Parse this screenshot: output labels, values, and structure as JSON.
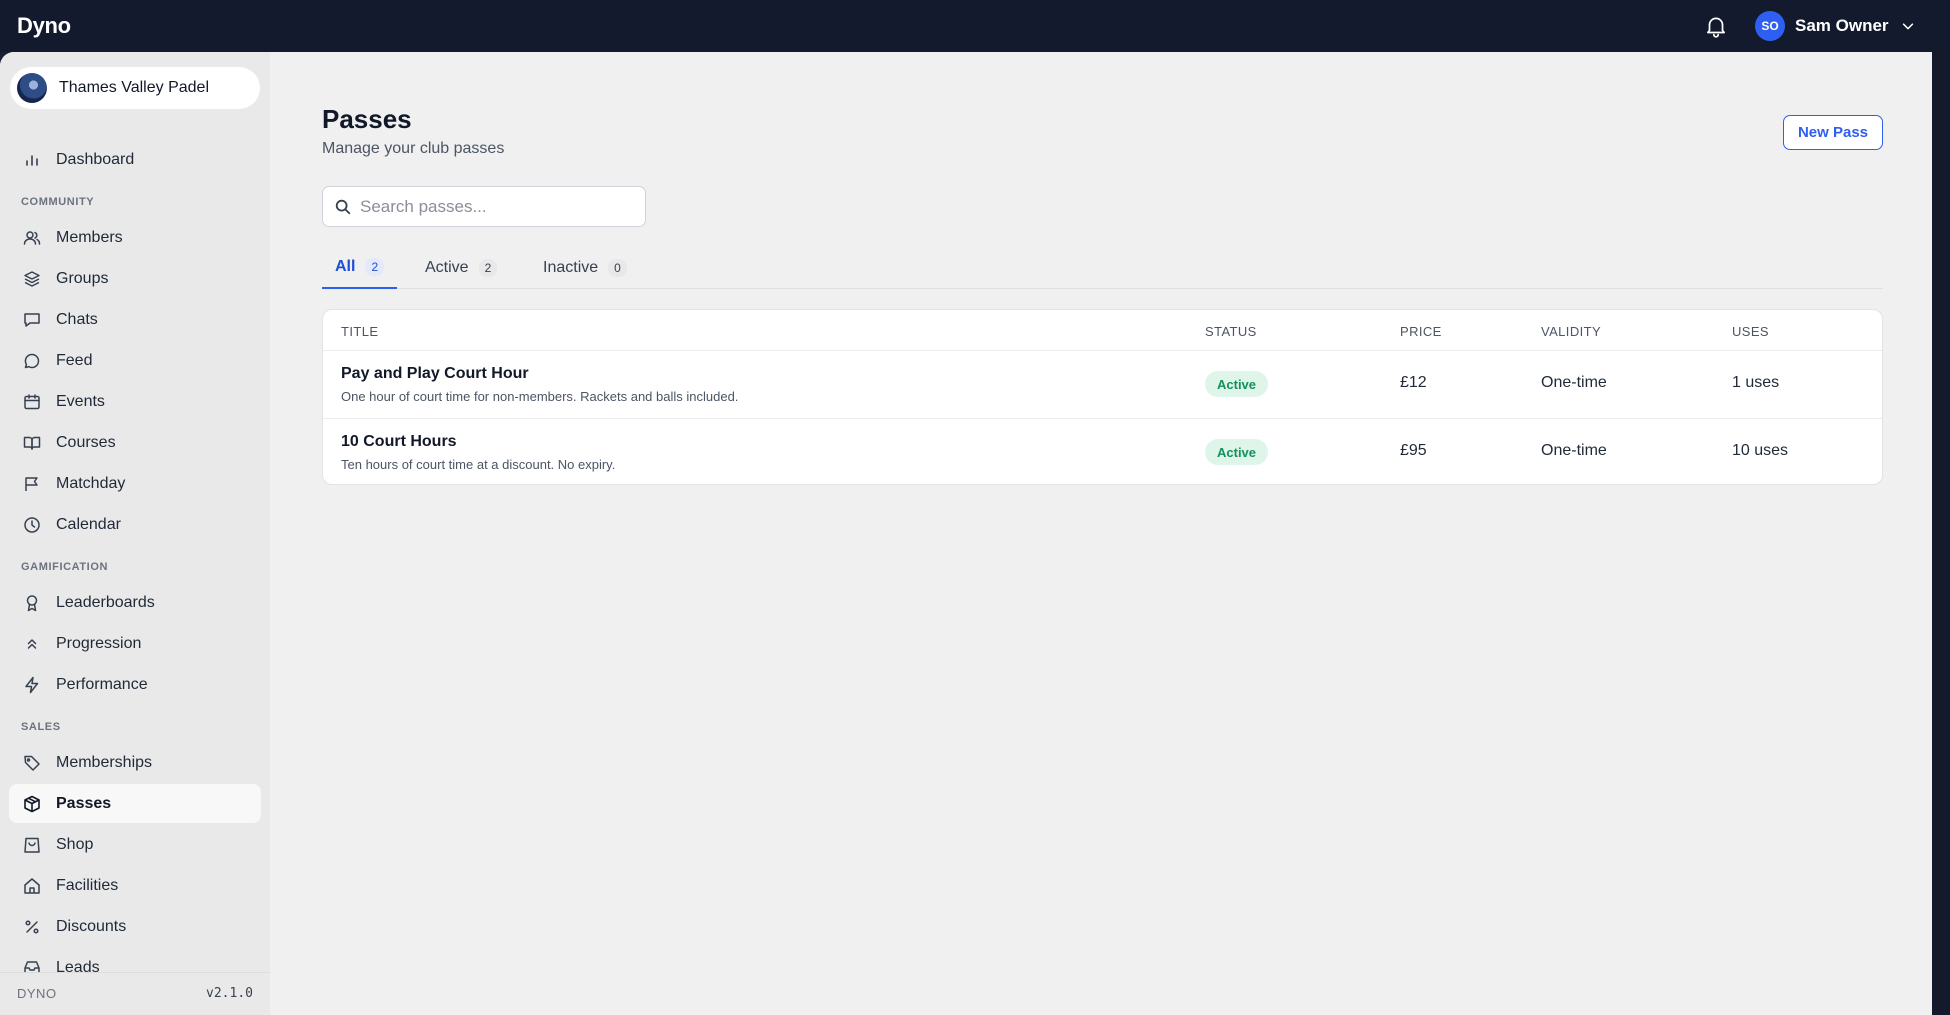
{
  "app": {
    "brand": "Dyno"
  },
  "user": {
    "initials": "SO",
    "name": "Sam Owner"
  },
  "org": {
    "name": "Thames Valley Padel"
  },
  "sidebar": {
    "dashboard": "Dashboard",
    "sections": {
      "community": "COMMUNITY",
      "gamification": "GAMIFICATION",
      "sales": "SALES"
    },
    "community_items": [
      "Members",
      "Groups",
      "Chats",
      "Feed",
      "Events",
      "Courses",
      "Matchday",
      "Calendar"
    ],
    "gamification_items": [
      "Leaderboards",
      "Progression",
      "Performance"
    ],
    "sales_items": [
      "Memberships",
      "Passes",
      "Shop",
      "Facilities",
      "Discounts",
      "Leads"
    ],
    "active_item": "Passes",
    "footer": {
      "name": "DYNO",
      "version": "v2.1.0"
    }
  },
  "page": {
    "title": "Passes",
    "subtitle": "Manage your club passes",
    "new_button": "New Pass"
  },
  "search": {
    "placeholder": "Search passes..."
  },
  "tabs": [
    {
      "label": "All",
      "count": "2",
      "active": true
    },
    {
      "label": "Active",
      "count": "2",
      "active": false
    },
    {
      "label": "Inactive",
      "count": "0",
      "active": false
    }
  ],
  "table": {
    "headers": [
      "TITLE",
      "STATUS",
      "PRICE",
      "VALIDITY",
      "USES"
    ],
    "rows": [
      {
        "title": "Pay and Play Court Hour",
        "description": "One hour of court time for non-members. Rackets and balls included.",
        "status": "Active",
        "price": "£12",
        "validity": "One-time",
        "uses": "1 uses"
      },
      {
        "title": "10 Court Hours",
        "description": "Ten hours of court time at a discount. No expiry.",
        "status": "Active",
        "price": "£95",
        "validity": "One-time",
        "uses": "10 uses"
      }
    ]
  },
  "colors": {
    "topbar": "#131a2e",
    "accent": "#2f5ff0",
    "active_badge_bg": "#dff5ea",
    "active_badge_text": "#12925a"
  }
}
